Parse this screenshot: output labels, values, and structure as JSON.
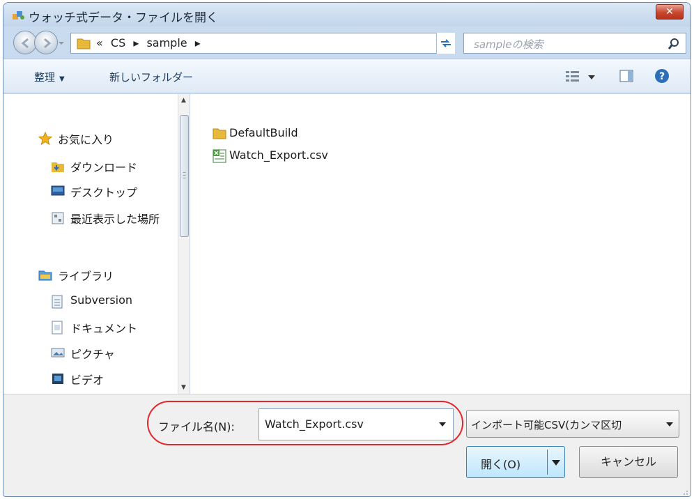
{
  "window": {
    "title": "ウォッチ式データ・ファイルを開く",
    "close_label": "✕"
  },
  "address": {
    "crumbs": [
      "«",
      "CS",
      "▸",
      "sample",
      "▸"
    ]
  },
  "search": {
    "placeholder": "sampleの検索"
  },
  "toolbar": {
    "organize_label": "整理",
    "new_folder_label": "新しいフォルダー"
  },
  "nav_pane": {
    "items": [
      {
        "label": "お気に入り",
        "icon": "star-icon"
      },
      {
        "label": "ダウンロード",
        "icon": "downloads-icon"
      },
      {
        "label": "デスクトップ",
        "icon": "desktop-icon"
      },
      {
        "label": "最近表示した場所",
        "icon": "recent-places-icon"
      },
      {
        "label": "ライブラリ",
        "icon": "library-icon"
      },
      {
        "label": "Subversion",
        "icon": "subversion-library-icon"
      },
      {
        "label": "ドキュメント",
        "icon": "documents-icon"
      },
      {
        "label": "ピクチャ",
        "icon": "pictures-icon"
      },
      {
        "label": "ビデオ",
        "icon": "videos-icon"
      }
    ]
  },
  "files": [
    {
      "name": "DefaultBuild",
      "icon": "folder-icon"
    },
    {
      "name": "Watch_Export.csv",
      "icon": "csv-file-icon"
    }
  ],
  "bottom": {
    "filename_label": "ファイル名(N):",
    "filename_value": "Watch_Export.csv",
    "file_type_value": "インポート可能CSV(カンマ区切",
    "open_label": "開く(O)",
    "cancel_label": "キャンセル"
  },
  "colors": {
    "highlight": "#e4252b",
    "close_button": "#c7482f",
    "folder": "#e8b83a"
  }
}
